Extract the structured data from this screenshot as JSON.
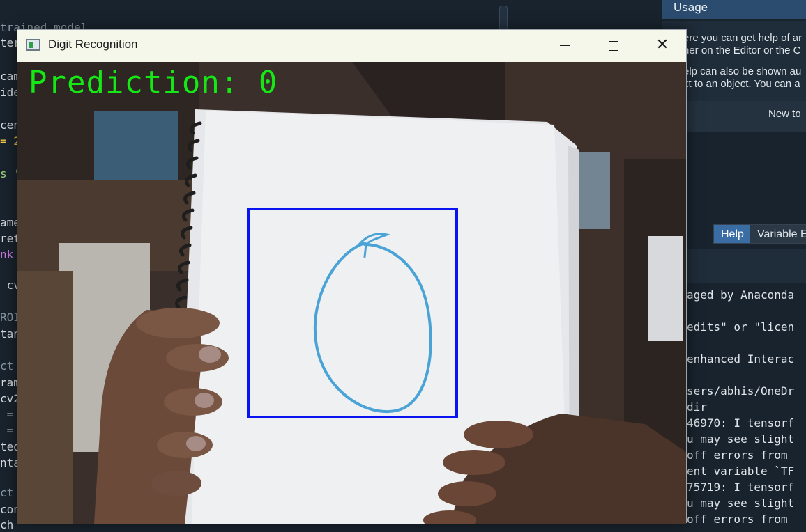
{
  "editor": {
    "lines": [
      {
        "text": "trained model",
        "color": "#8b98a5"
      },
      {
        "text": "ter",
        "color": "#d6dbe0"
      },
      {
        "text": "cam",
        "color": "#d6dbe0"
      },
      {
        "text": "ide",
        "color": "#d6dbe0"
      },
      {
        "text": "cen",
        "color": "#d6dbe0"
      },
      {
        "text": "= 2",
        "color": "#f2c94c"
      },
      {
        "text": "s '",
        "color": "#9fd37f"
      },
      {
        "text": "ame",
        "color": "#d6dbe0"
      },
      {
        "text": "ret",
        "color": "#d6dbe0"
      },
      {
        "text": "nk",
        "color": "#c678dd"
      },
      {
        "text": " cv",
        "color": "#d6dbe0"
      },
      {
        "text": "ROI",
        "color": "#8b98a5"
      },
      {
        "text": "tan",
        "color": "#d6dbe0"
      },
      {
        "text": "ct",
        "color": "#8b98a5"
      },
      {
        "text": "ram",
        "color": "#d6dbe0"
      },
      {
        "text": "cv2",
        "color": "#d6dbe0"
      },
      {
        "text": " =",
        "color": "#d6dbe0"
      },
      {
        "text": " =",
        "color": "#d6dbe0"
      },
      {
        "text": "ted",
        "color": "#d6dbe0"
      },
      {
        "text": "nta",
        "color": "#d6dbe0"
      },
      {
        "text": "ct",
        "color": "#8b98a5"
      },
      {
        "text": "con",
        "color": "#d6dbe0"
      },
      {
        "text": "ch",
        "color": "#d6dbe0"
      }
    ]
  },
  "right_pane": {
    "title": "Usage",
    "help_lines": [
      "ere you can get help of ar",
      "ner on the Editor or the C",
      "elp can also be shown au",
      "xt to an object. You can a"
    ],
    "new_to": "New to",
    "tabs": {
      "help": "Help",
      "variable_explorer": "Variable E"
    }
  },
  "console": {
    "lines": [
      "aged by Anaconda",
      "",
      "edits\" or \"licen",
      "",
      "enhanced Interac",
      "",
      "sers/abhis/OneDr",
      "dir",
      "46970: I tensorf",
      "u may see slight",
      "off errors from",
      "ent variable `TF",
      "75719: I tensorf",
      "u may see slight",
      "off errors from"
    ]
  },
  "window": {
    "title": "Digit Recognition",
    "controls": {
      "minimize": "minimize",
      "maximize": "maximize",
      "close": "✕"
    },
    "prediction_label": "Prediction: 0",
    "prediction_color": "#15e815",
    "roi_color": "#0a14f0",
    "drawn_digit_color": "#4aa3d6"
  }
}
